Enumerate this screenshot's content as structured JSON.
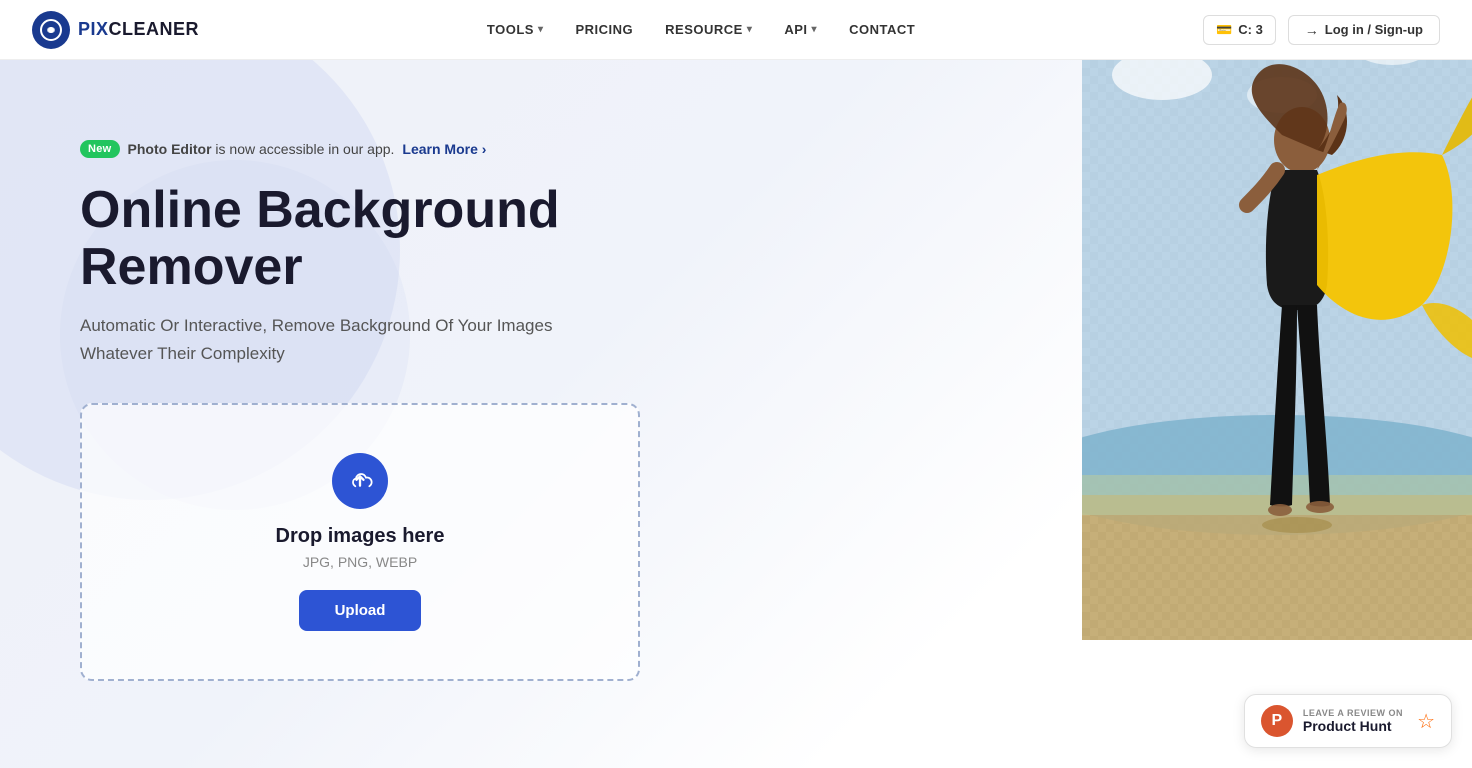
{
  "navbar": {
    "logo_text_pix": "PIX",
    "logo_text_cleaner": "CLEANER",
    "nav_items": [
      {
        "label": "TOOLS",
        "has_dropdown": true
      },
      {
        "label": "PRICING",
        "has_dropdown": false
      },
      {
        "label": "RESOURCE",
        "has_dropdown": true
      },
      {
        "label": "API",
        "has_dropdown": true
      },
      {
        "label": "CONTACT",
        "has_dropdown": false
      }
    ],
    "credits_icon": "💳",
    "credits_count": "C: 3",
    "login_label": "Log in / Sign-up"
  },
  "hero": {
    "badge_new": "New",
    "badge_text": "Photo Editor",
    "badge_subtext": " is now accessible in our app. ",
    "badge_link": "Learn More",
    "title": "Online Background Remover",
    "subtitle_line1": "Automatic Or Interactive, Remove Background Of Your Images",
    "subtitle_line2": "Whatever Their Complexity",
    "upload_area": {
      "drop_text": "Drop images here",
      "formats": "JPG, PNG, WEBP",
      "upload_button": "Upload"
    }
  },
  "product_hunt": {
    "label": "LEAVE A REVIEW ON",
    "name": "Product Hunt",
    "star": "☆"
  }
}
